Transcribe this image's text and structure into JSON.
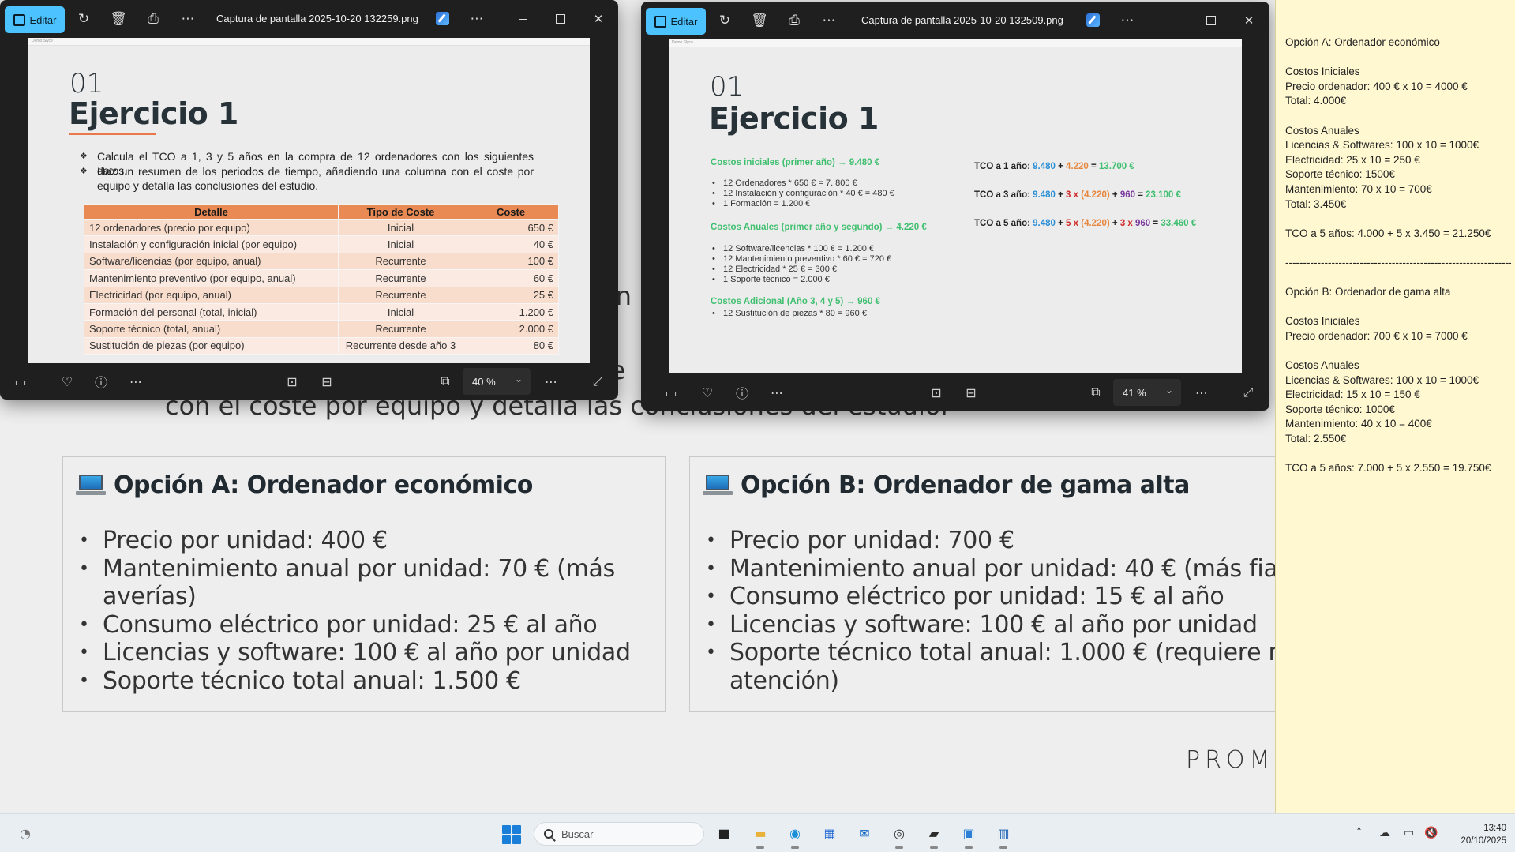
{
  "background_slide": {
    "partial_text_1": "en",
    "partial_text_2": "re",
    "partial_text_right": "u",
    "subtitle_line": "con el coste por equipo  y detalla las conclusiones del estudio.",
    "option_a": {
      "title": "Opción A: Ordenador económico",
      "items": [
        "Precio por unidad: 400 €",
        "Mantenimiento anual por unidad: 70 € (más",
        "averías)",
        "Consumo eléctrico por unidad: 25 € al año",
        "Licencias y software: 100 € al año por unidad",
        "Soporte técnico total anual: 1.500 €"
      ]
    },
    "option_b": {
      "title": "Opción B: Ordenador de gama alta",
      "items": [
        "Precio por unidad: 700 €",
        "Mantenimiento anual por unidad: 40 € (más fia",
        "Consumo eléctrico por unidad: 15 € al año",
        "Licencias y software: 100 € al año por unidad",
        "Soporte técnico total anual: 1.000 € (requiere m",
        "atención)"
      ]
    },
    "brand": "PROME"
  },
  "window1": {
    "edit_label": "Editar",
    "title": "Captura de pantalla 2025-10-20 132259.png",
    "zoom": "40 %",
    "shot": {
      "app_label": "Demo Slyce",
      "number": "01",
      "title": "Ejercicio 1",
      "bullets": [
        "Calcula el TCO a 1,  3 y 5 años en la compra de 12 ordenadores con los siguientes datos.",
        "Haz un resumen de los periodos de tiempo, añadiendo una columna con el coste por equipo  y detalla las conclusiones del estudio."
      ],
      "table": {
        "headers": [
          "Detalle",
          "Tipo de Coste",
          "Coste"
        ],
        "rows": [
          [
            "12 ordenadores (precio por equipo)",
            "Inicial",
            "650 €"
          ],
          [
            "Instalación y configuración inicial (por equipo)",
            "Inicial",
            "40 €"
          ],
          [
            "Software/licencias (por equipo, anual)",
            "Recurrente",
            "100 €"
          ],
          [
            "Mantenimiento preventivo (por equipo, anual)",
            "Recurrente",
            "60 €"
          ],
          [
            "Electricidad (por equipo, anual)",
            "Recurrente",
            "25 €"
          ],
          [
            "Formación del personal (total, inicial)",
            "Inicial",
            "1.200 €"
          ],
          [
            "Soporte técnico (total, anual)",
            "Recurrente",
            "2.000 €"
          ],
          [
            "Sustitución de piezas (por equipo)",
            "Recurrente desde año 3",
            "80 €"
          ]
        ]
      }
    }
  },
  "window2": {
    "edit_label": "Editar",
    "title": "Captura de pantalla 2025-10-20 132509.png",
    "zoom": "41 %",
    "shot": {
      "app_label": "Demo Slyce",
      "number": "01",
      "title": "Ejercicio 1",
      "initial_head": "Costos iniciales (primer año) → 9.480 €",
      "initial_items": [
        "12 Ordenadores  * 650 € = 7. 800 €",
        "12 Instalación y configuración * 40 € = 480 €",
        "1 Formación = 1.200 €"
      ],
      "annual_head": "Costos Anuales (primer año y segundo) → 4.220 €",
      "annual_items": [
        "12 Software/licencias * 100 € = 1.200 €",
        "12 Mantenimiento preventivo * 60 € = 720 €",
        "12 Electricidad * 25 € = 300 €",
        "1 Soporte técnico = 2.000 €"
      ],
      "additional_head": "Costos Adicional (Año 3, 4 y 5) → 960 €",
      "additional_items": [
        "12 Sustitución de piezas * 80 = 960 €"
      ],
      "tco1": {
        "label": "TCO a 1 año:",
        "a": "9.480",
        "plus": "+",
        "b": "4.220",
        "eq": "=",
        "total": "13.700 €"
      },
      "tco3": {
        "label": "TCO a 3 año:",
        "a": "9.480",
        "plus1": "+",
        "mult": "3 x",
        "b": "(4.220)",
        "plus2": "+",
        "c": "960",
        "eq": "=",
        "total": "23.100 €"
      },
      "tco5": {
        "label": "TCO a 5 año:",
        "a": "9.480",
        "plus1": "+",
        "mult1": "5 x",
        "b": "(4.220)",
        "plus2": "+",
        "mult2": "3 x",
        "c": "960",
        "eq": "=",
        "total": "33.460 €"
      }
    }
  },
  "notepad": {
    "lines": [
      "Opción A: Ordenador económico",
      "",
      "Costos Iniciales",
      "Precio ordenador: 400 € x 10 = 4000 €",
      "Total: 4.000€",
      "",
      "Costos Anuales",
      "Licencias & Softwares: 100 x 10 = 1000€",
      "Electricidad: 25 x 10 = 250 €",
      "Soporte técnico: 1500€",
      "Mantenimiento: 70 x 10 = 700€",
      "Total: 3.450€",
      "",
      "TCO a 5 años: 4.000 + 5 x 3.450 = 21.250€",
      "",
      "------------------------------------------------------------------",
      "",
      "Opción B: Ordenador de gama alta",
      "",
      "Costos Iniciales",
      "Precio ordenador: 700 € x 10 = 7000 €",
      "",
      "Costos Anuales",
      "Licencias & Softwares: 100 x 10 = 1000€",
      "Electricidad: 15 x 10 = 150 €",
      "Soporte técnico: 1000€",
      "Mantenimiento: 40 x 10 = 400€",
      "Total: 2.550€",
      "",
      "TCO a 5 años: 7.000 + 5 x 2.550 = 19.750€"
    ]
  },
  "taskbar": {
    "search_placeholder": "Buscar",
    "time": "13:40",
    "date": "20/10/2025"
  },
  "colors": {
    "edit_accent": "#4cc2ff",
    "table_header": "#e98a55",
    "notepad_bg": "#fff8d1",
    "green_heading": "#3fbf6f",
    "blue_value": "#2a8fd6",
    "orange_value": "#e6873f",
    "red_value": "#d02a2a",
    "purple_value": "#7a3a9e"
  }
}
